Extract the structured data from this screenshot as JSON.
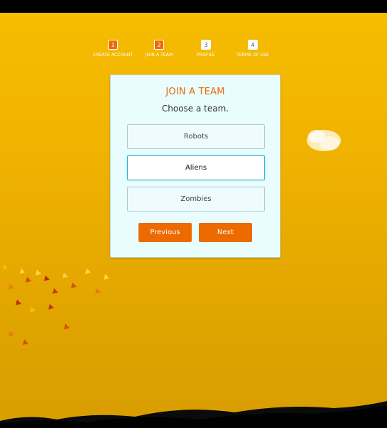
{
  "steps": [
    {
      "number": "1",
      "label": "CREATE ACCOUNT",
      "state": "active"
    },
    {
      "number": "2",
      "label": "JOIN A TEAM",
      "state": "active"
    },
    {
      "number": "3",
      "label": "PROFILE",
      "state": "inactive"
    },
    {
      "number": "4",
      "label": "TERMS OF USE",
      "state": "inactive"
    }
  ],
  "card": {
    "title": "JOIN A TEAM",
    "subtitle": "Choose a team.",
    "options": [
      {
        "label": "Robots",
        "selected": false
      },
      {
        "label": "Aliens",
        "selected": true
      },
      {
        "label": "Zombies",
        "selected": false
      }
    ],
    "buttons": {
      "previous": "Previous",
      "next": "Next"
    }
  },
  "colors": {
    "accent": "#ec6a00",
    "background_top": "#f6bd00",
    "background_bottom": "#d89d00",
    "card_bg": "#e9fdff",
    "selected_border": "#39b2d6"
  },
  "decor": {
    "cloud_icon": "cloud-icon",
    "leaves_icon": "leaves-icon",
    "grass_icon": "grass-icon"
  }
}
